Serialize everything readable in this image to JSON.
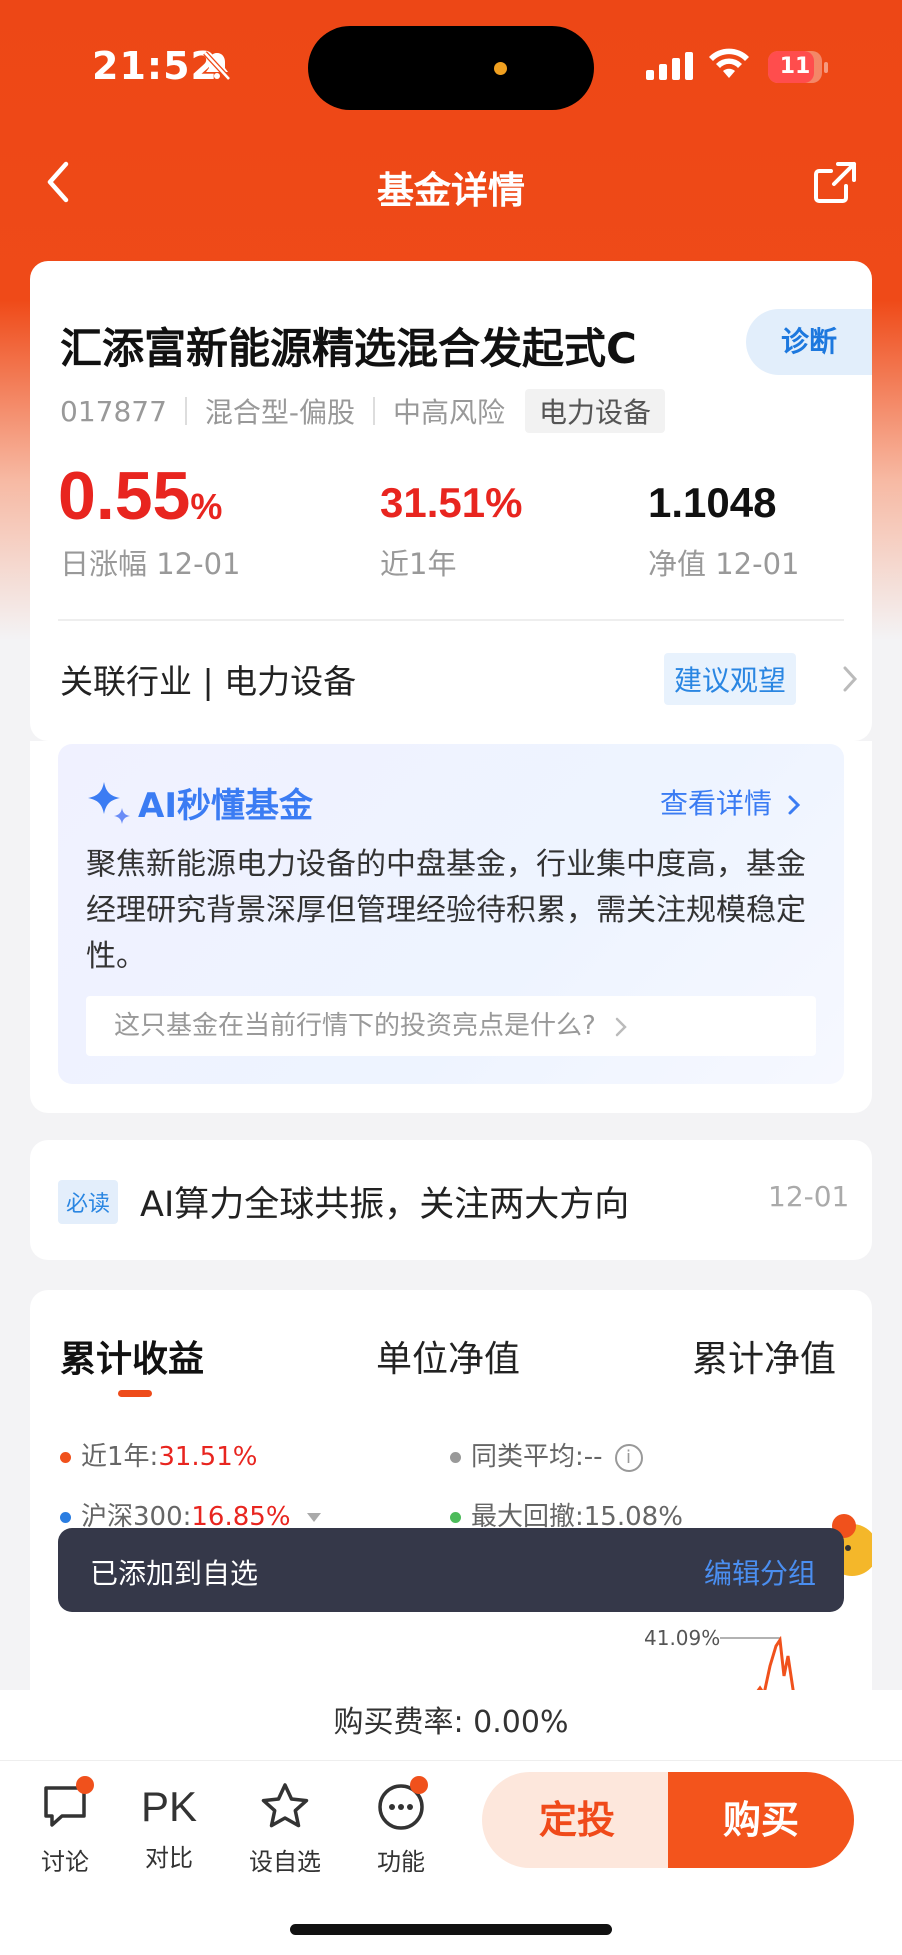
{
  "status_bar": {
    "time": "21:52",
    "battery": "11"
  },
  "nav": {
    "title": "基金详情"
  },
  "fund": {
    "name": "汇添富新能源精选混合发起式C",
    "diagnose_label": "诊断",
    "code": "017877",
    "type": "混合型-偏股",
    "risk": "中高风险",
    "sector_tag": "电力设备",
    "daily_change": "0.55",
    "daily_change_unit": "%",
    "daily_change_label": "日涨幅 12-01",
    "year_return": "31.51%",
    "year_return_label": "近1年",
    "nav_value": "1.1048",
    "nav_label": "净值 12-01",
    "industry_text": "关联行业 | 电力设备",
    "advice": "建议观望"
  },
  "ai": {
    "title": "AI秒懂基金",
    "more": "查看详情",
    "summary": "聚焦新能源电力设备的中盘基金，行业集中度高，基金经理研究背景深厚但管理经验待积累，需关注规模稳定性。",
    "question": "这只基金在当前行情下的投资亮点是什么?"
  },
  "news": {
    "badge": "必读",
    "headline": "AI算力全球共振，关注两大方向",
    "date": "12-01"
  },
  "perf": {
    "tabs": [
      "累计收益",
      "单位净值",
      "累计净值"
    ],
    "legend": [
      {
        "label": "近1年:",
        "value": "31.51%",
        "color": "#f0511c"
      },
      {
        "label": "同类平均:",
        "value": "--",
        "color": "#999999"
      },
      {
        "label": "沪深300:",
        "value": "16.85%",
        "color": "#2a7de1"
      },
      {
        "label": "最大回撤:",
        "value": "15.08%",
        "color": "#4cbb5a"
      }
    ],
    "peak_label": "41.09%"
  },
  "toast": {
    "message": "已添加到自选",
    "action": "编辑分组"
  },
  "fee": {
    "text": "购买费率: 0.00%"
  },
  "bottom_bar": {
    "discuss": "讨论",
    "pk_glyph": "PK",
    "compare": "对比",
    "watchlist": "设自选",
    "functions": "功能",
    "sip": "定投",
    "buy": "购买"
  },
  "colors": {
    "brand": "#ee4b1a",
    "accent_blue": "#2a86e2",
    "rise": "#e8251f"
  }
}
